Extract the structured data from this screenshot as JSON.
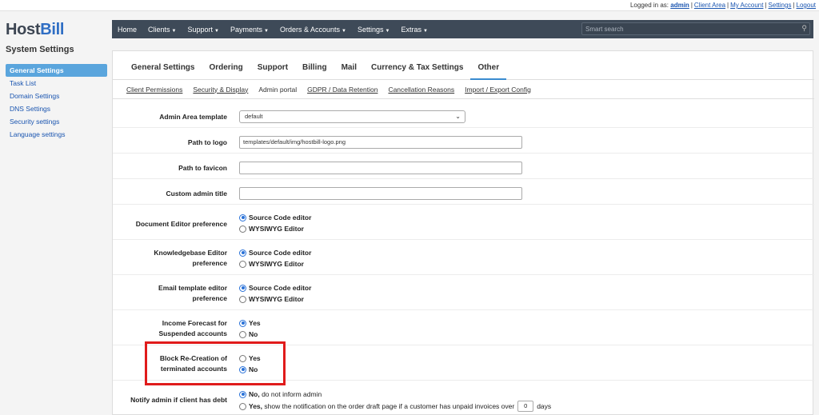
{
  "topbar": {
    "logged_in_as": "Logged in as:",
    "user": "admin",
    "links": [
      "Client Area",
      "My Account",
      "Settings",
      "Logout"
    ]
  },
  "logo": {
    "part1": "Host",
    "part2": "Bill"
  },
  "page_title": "System Settings",
  "sidebar": {
    "items": [
      {
        "label": "General Settings",
        "active": true
      },
      {
        "label": "Task List"
      },
      {
        "label": "Domain Settings"
      },
      {
        "label": "DNS Settings"
      },
      {
        "label": "Security settings"
      },
      {
        "label": "Language settings"
      }
    ]
  },
  "navbar": {
    "items": [
      "Home",
      "Clients",
      "Support",
      "Payments",
      "Orders & Accounts",
      "Settings",
      "Extras"
    ],
    "search_placeholder": "Smart search"
  },
  "tabs": [
    "General Settings",
    "Ordering",
    "Support",
    "Billing",
    "Mail",
    "Currency & Tax Settings",
    "Other"
  ],
  "active_tab": "Other",
  "subtabs": [
    "Client Permissions",
    "Security & Display",
    "Admin portal",
    "GDPR / Data Retention",
    "Cancellation Reasons",
    "Import / Export Config"
  ],
  "active_subtab": "Admin portal",
  "form": {
    "admin_template": {
      "label": "Admin Area template",
      "value": "default"
    },
    "logo_path": {
      "label": "Path to logo",
      "value": "templates/default/img/hostbill-logo.png"
    },
    "favicon_path": {
      "label": "Path to favicon",
      "value": ""
    },
    "admin_title": {
      "label": "Custom admin title",
      "value": ""
    },
    "doc_editor": {
      "label": "Document Editor preference",
      "opt1": "Source Code editor",
      "opt2": "WYSIWYG Editor"
    },
    "kb_editor": {
      "label1": "Knowledgebase Editor",
      "label2": "preference",
      "opt1": "Source Code editor",
      "opt2": "WYSIWYG Editor"
    },
    "email_editor": {
      "label1": "Email template editor",
      "label2": "preference",
      "opt1": "Source Code editor",
      "opt2": "WYSIWYG Editor"
    },
    "income_forecast": {
      "label1": "Income Forecast for",
      "label2": "Suspended accounts",
      "opt1": "Yes",
      "opt2": "No"
    },
    "block_recreation": {
      "label1": "Block Re-Creation of",
      "label2": "terminated accounts",
      "opt1": "Yes",
      "opt2": "No"
    },
    "notify_debt": {
      "label": "Notify admin if client has debt",
      "opt1_bold": "No,",
      "opt1_rest": "do not inform admin",
      "opt2_bold": "Yes,",
      "opt2_rest": "show the notification on the order draft page if a customer has unpaid invoices over",
      "days_value": "0",
      "days_label": "days"
    }
  },
  "colors": {
    "navbar": "#3e4a58",
    "accent": "#5aa5dd",
    "highlight": "#e01b1b"
  }
}
